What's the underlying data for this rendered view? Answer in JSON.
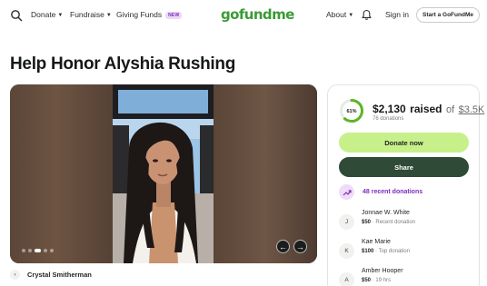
{
  "header": {
    "nav": [
      {
        "label": "Donate",
        "has_caret": true
      },
      {
        "label": "Fundraise",
        "has_caret": true
      },
      {
        "label": "Giving Funds",
        "badge": "NEW"
      }
    ],
    "logo": "gofundme",
    "signin_label": "Sign in",
    "start_label": "Start a GoFundMe",
    "icons": {
      "search": "search-icon",
      "bell": "bell-icon"
    },
    "about_label": "About"
  },
  "page": {
    "title": "Help Honor Alyshia Rushing"
  },
  "media": {
    "slide_count": 5,
    "active_slide": 3,
    "prev_icon": "←",
    "next_icon": "→"
  },
  "organizer": {
    "name": "Crystal Smitherman",
    "avatar_icon": "‹"
  },
  "donation": {
    "percent_label": "61%",
    "percent": 61,
    "raised_amount": "$2,130",
    "raised_word": "raised",
    "of_label": "of",
    "goal": "$3.5K",
    "donations_count": "76 donations",
    "donate_label": "Donate now",
    "share_label": "Share",
    "recent_label": "48 recent donations",
    "colors": {
      "accent": "#c7f08a",
      "share": "#2f4a36",
      "purple": "#7b2cbf",
      "ring": "#5bb524"
    },
    "donors": [
      {
        "initial": "J",
        "name": "Jonnae W. White",
        "amount": "$50",
        "note": "Recent donation"
      },
      {
        "initial": "K",
        "name": "Kae Marie",
        "amount": "$100",
        "note": "Top donation"
      },
      {
        "initial": "A",
        "name": "Amber Hooper",
        "amount": "$50",
        "note": "19 hrs"
      }
    ]
  }
}
